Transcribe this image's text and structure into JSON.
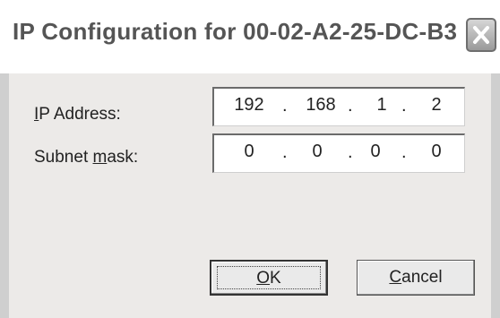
{
  "window": {
    "title": "IP Configuration for  00-02-A2-25-DC-B3",
    "close_icon": "close-icon"
  },
  "ip_address": {
    "label_pre": "",
    "label_mnemonic": "I",
    "label_post": "P Address:",
    "octets": [
      "192",
      "168",
      "1",
      "2"
    ]
  },
  "subnet_mask": {
    "label_pre": "Subnet ",
    "label_mnemonic": "m",
    "label_post": "ask:",
    "octets": [
      "0",
      "0",
      "0",
      "0"
    ]
  },
  "buttons": {
    "ok": {
      "pre": "",
      "mnemonic": "O",
      "post": "K"
    },
    "cancel": {
      "pre": "",
      "mnemonic": "C",
      "post": "ancel"
    }
  },
  "separator": "."
}
